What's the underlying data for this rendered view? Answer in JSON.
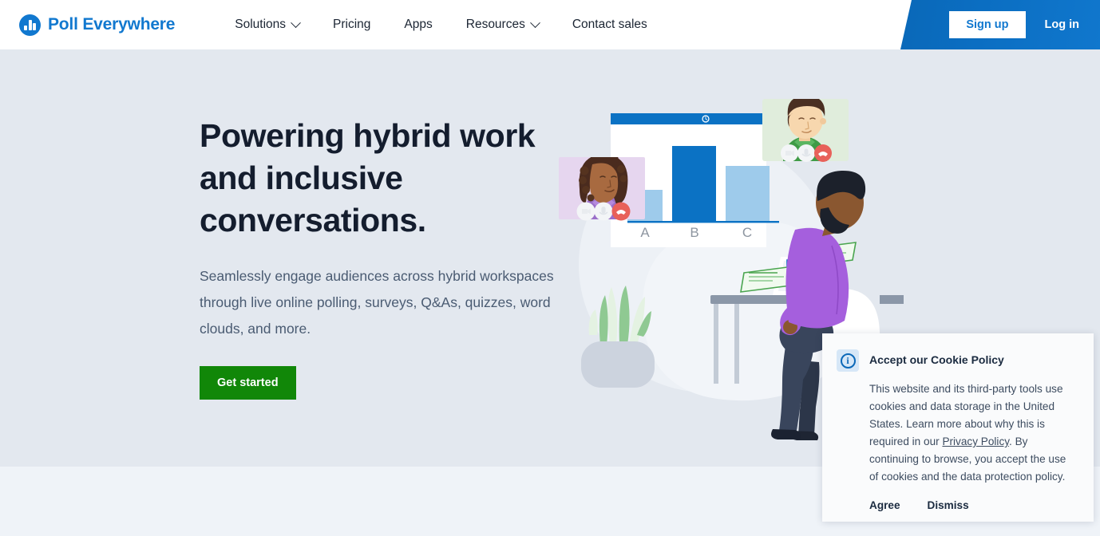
{
  "nav": {
    "logo_text": "Poll Everywhere",
    "logo_icon": "bar-chart-circle-icon",
    "links": [
      {
        "label": "Solutions",
        "has_chevron": true
      },
      {
        "label": "Pricing",
        "has_chevron": false
      },
      {
        "label": "Apps",
        "has_chevron": false
      },
      {
        "label": "Resources",
        "has_chevron": true
      },
      {
        "label": "Contact sales",
        "has_chevron": false
      }
    ],
    "signup_label": "Sign up",
    "login_label": "Log in",
    "accent_blue": "#1178cf",
    "panel_blue": "#0b6ec2"
  },
  "hero": {
    "title": "Powering hybrid work and inclusive conversations.",
    "subtitle": "Seamlessly engage audiences across hybrid workspaces through live online polling, surveys, Q&As, quizzes, word clouds, and more.",
    "cta_label": "Get started",
    "cta_color": "#118708",
    "background": "#e3e8ef",
    "title_color": "#141d2e",
    "subtitle_color": "#4a5b72"
  },
  "illustration": {
    "name": "hybrid-meeting-illustration",
    "poll_chart": {
      "type": "bar",
      "categories": [
        "A",
        "B",
        "C"
      ],
      "values": [
        28,
        72,
        50
      ],
      "bar_colors": [
        "#9ecbeb",
        "#0b72c4",
        "#9ecbeb"
      ],
      "title": "",
      "xlabel": "",
      "ylabel": "",
      "ylim": [
        0,
        100
      ]
    },
    "video_tiles": [
      {
        "name": "participant-tile-woman",
        "background": "#e6d6ef"
      },
      {
        "name": "participant-tile-man",
        "background": "#e0eddc"
      }
    ],
    "tile_controls": [
      "camera-icon",
      "microphone-icon",
      "end-call-icon"
    ],
    "plant": "potted-plant",
    "person": "seated-person-at-desk",
    "laptop": "laptop-with-poll-results",
    "response_cards": 2
  },
  "cookie_banner": {
    "title": "Accept our Cookie Policy",
    "icon": "info-circle-icon",
    "body_part1": "This website and its third-party tools use cookies and data storage in the United States. Learn more about why this is required in our ",
    "link_label": "Privacy Policy",
    "body_part2": ". By continuing to browse, you accept the use of cookies and the data protection policy.",
    "agree_label": "Agree",
    "dismiss_label": "Dismiss"
  },
  "lower_section": {
    "background": "#eff3f8"
  }
}
